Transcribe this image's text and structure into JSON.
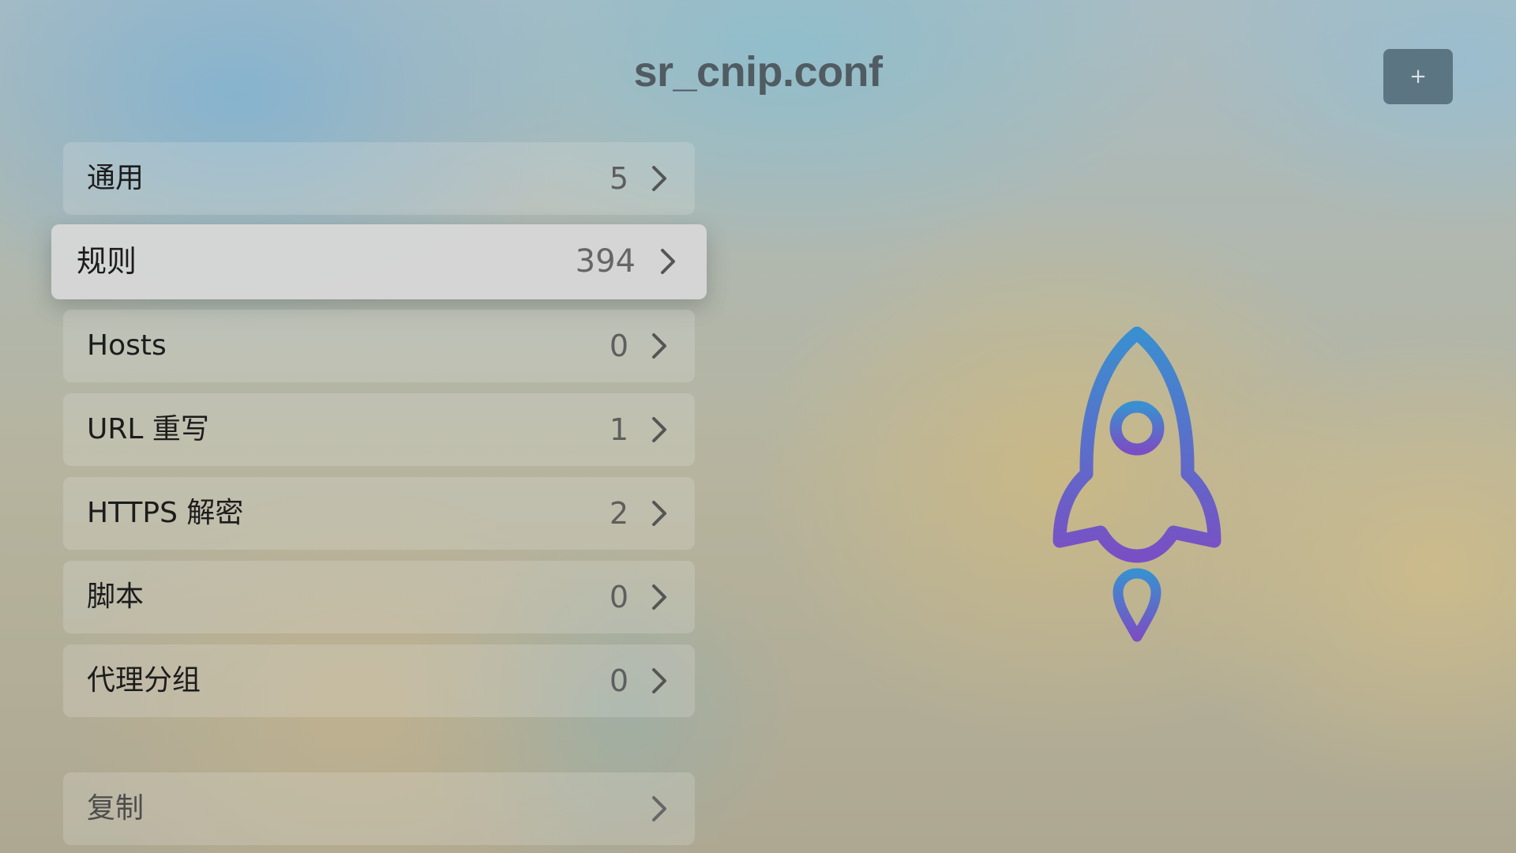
{
  "title": "sr_cnip.conf",
  "add_button": {
    "label": "+"
  },
  "menu": {
    "items": [
      {
        "label": "通用",
        "count": "5"
      },
      {
        "label": "规则",
        "count": "394",
        "selected": true
      },
      {
        "label": "Hosts",
        "count": "0"
      },
      {
        "label": "URL 重写",
        "count": "1"
      },
      {
        "label": "HTTPS 解密",
        "count": "2"
      },
      {
        "label": "脚本",
        "count": "0"
      },
      {
        "label": "代理分组",
        "count": "0"
      }
    ],
    "copy": {
      "label": "复制"
    }
  },
  "icons": {
    "chevron": "chevron-right-icon",
    "logo": "rocket-icon"
  },
  "colors": {
    "rocket_top": "#3a8fd0",
    "rocket_bottom": "#7a4fc4"
  }
}
